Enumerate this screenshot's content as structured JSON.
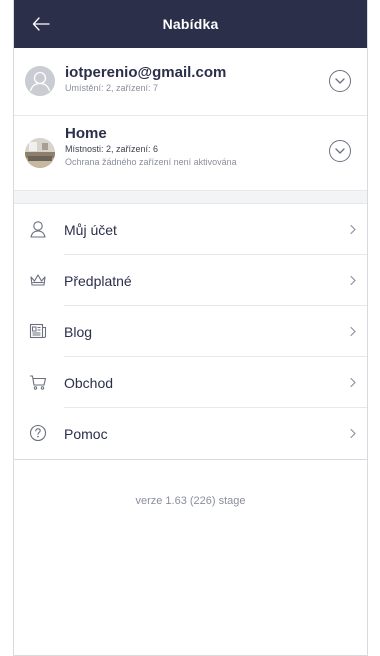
{
  "header": {
    "title": "Nabídka",
    "back_icon": "arrow-left-icon",
    "background_color": "#2b2f4a"
  },
  "account": {
    "email": "iotperenio@gmail.com",
    "details": "Umístění: 2, zařízení: 7"
  },
  "location": {
    "name": "Home",
    "details": "Místnosti: 2, zařízení: 6",
    "status": "Ochrana žádného zařízení není aktivována"
  },
  "menu": {
    "items": [
      {
        "label": "Můj účet",
        "icon": "user-icon"
      },
      {
        "label": "Předplatné",
        "icon": "crown-icon"
      },
      {
        "label": "Blog",
        "icon": "blog-icon"
      },
      {
        "label": "Obchod",
        "icon": "cart-icon"
      },
      {
        "label": "Pomoc",
        "icon": "help-icon"
      }
    ]
  },
  "footer": {
    "version": "verze 1.63 (226) stage"
  }
}
